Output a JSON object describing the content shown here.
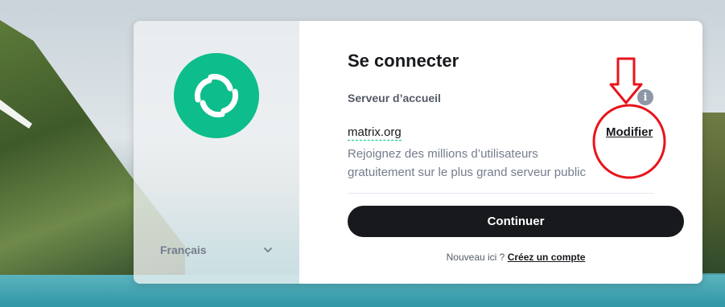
{
  "login": {
    "title": "Se connecter",
    "server_section_label": "Serveur d’accueil",
    "server_name": "matrix.org",
    "modify_label": "Modifier",
    "server_description": "Rejoignez des millions d’utilisateurs gratuitement sur le plus grand serveur public",
    "continue_label": "Continuer",
    "new_here_text": "Nouveau ici ?",
    "create_account_label": "Créez un compte"
  },
  "language": {
    "selected": "Français"
  },
  "icons": {
    "logo": "element-logo-icon",
    "info": "info-icon",
    "language_chevron": "chevron-down-icon",
    "annotation": "red-arrow-and-circle"
  },
  "colors": {
    "brand": "#0dbd8b",
    "button": "#17191c",
    "annotation": "#e8141c"
  }
}
